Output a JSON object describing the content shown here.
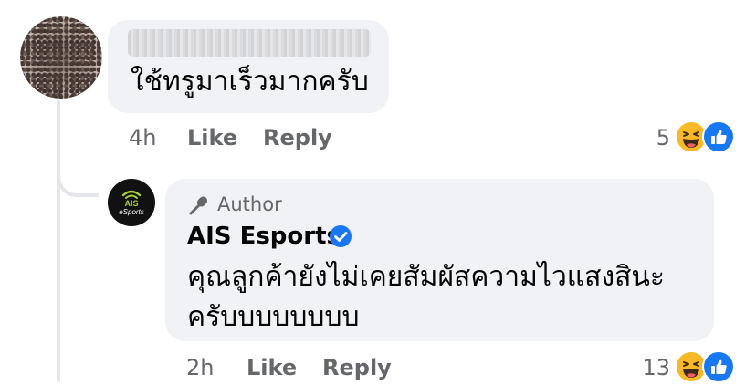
{
  "comment": {
    "text": "ใช้ทรูมาเร็วมากครับ",
    "time": "4h",
    "like_label": "Like",
    "reply_label": "Reply",
    "reaction_count": "5"
  },
  "reply": {
    "author_badge": "Author",
    "page_name": "AIS Esports",
    "text": "คุณลูกค้ายังไม่เคยสัมผัสความไวแสงสินะ ครับบบบบบบบ",
    "time": "2h",
    "like_label": "Like",
    "reply_label": "Reply",
    "reaction_count": "13",
    "logo_text_top": "AIS",
    "logo_text_bottom": "eSports"
  },
  "colors": {
    "bubble": "#f0f2f5",
    "meta_text": "#65676b",
    "verified": "#1877f2",
    "like": "#1877f2",
    "haha": "#f7b928",
    "logo_green": "#a6ce39"
  },
  "icons": [
    "haha-reaction-icon",
    "like-reaction-icon",
    "microphone-icon",
    "verified-badge-icon"
  ]
}
